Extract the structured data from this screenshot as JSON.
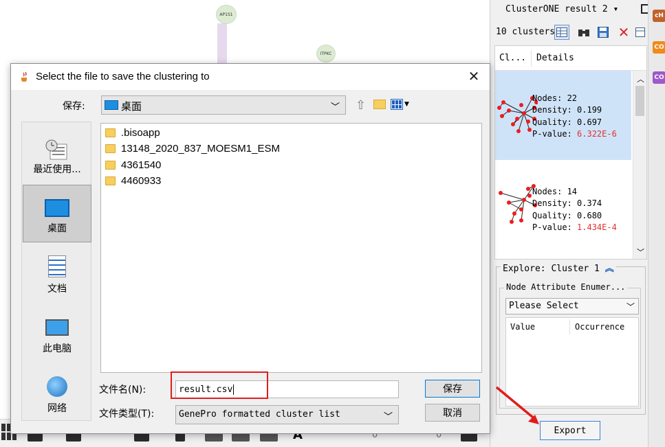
{
  "canvas": {
    "nodes": [
      {
        "label": "AP1S1"
      },
      {
        "label": "ITPKC"
      }
    ]
  },
  "right_panel": {
    "title": "ClusterONE result 2 ▾",
    "cluster_count": "10 clusters",
    "columns": [
      "Cl...",
      "Details"
    ],
    "clusters": [
      {
        "nodes": "Nodes: 22",
        "density": "Density: 0.199",
        "quality": "Quality: 0.697",
        "pvalue_label": "P-value: ",
        "pvalue": "6.322E-6"
      },
      {
        "nodes": "Nodes: 14",
        "density": "Density: 0.374",
        "quality": "Quality: 0.680",
        "pvalue_label": "P-value: ",
        "pvalue": "1.434E-4"
      }
    ],
    "explore": {
      "title": "Explore: Cluster 1",
      "attr_group": "Node Attribute Enumer...",
      "select_value": "Please Select",
      "value_col": "Value",
      "occurrence_col": "Occurrence"
    },
    "export_label": "Export",
    "side_badges": [
      "cH",
      "CO",
      "CO"
    ],
    "side_badge_colors": [
      "#c0622d",
      "#f08a1c",
      "#9f59c9"
    ]
  },
  "dialog": {
    "title": "Select the file to save the clustering to",
    "save_in_label": "保存:",
    "save_in_value": "桌面",
    "places": [
      {
        "label": "最近使用..."
      },
      {
        "label": "桌面"
      },
      {
        "label": "文档"
      },
      {
        "label": "此电脑"
      },
      {
        "label": "网络"
      }
    ],
    "files": [
      ".bisoapp",
      "13148_2020_837_MOESM1_ESM",
      "4361540",
      "4460933"
    ],
    "filename_label": "文件名(N):",
    "filename_value": "result.csv",
    "filetype_label": "文件类型(T):",
    "filetype_value": "GenePro formatted cluster list",
    "save_button": "保存",
    "cancel_button": "取消"
  },
  "toolbar": {
    "counters": [
      "0",
      "0"
    ]
  }
}
